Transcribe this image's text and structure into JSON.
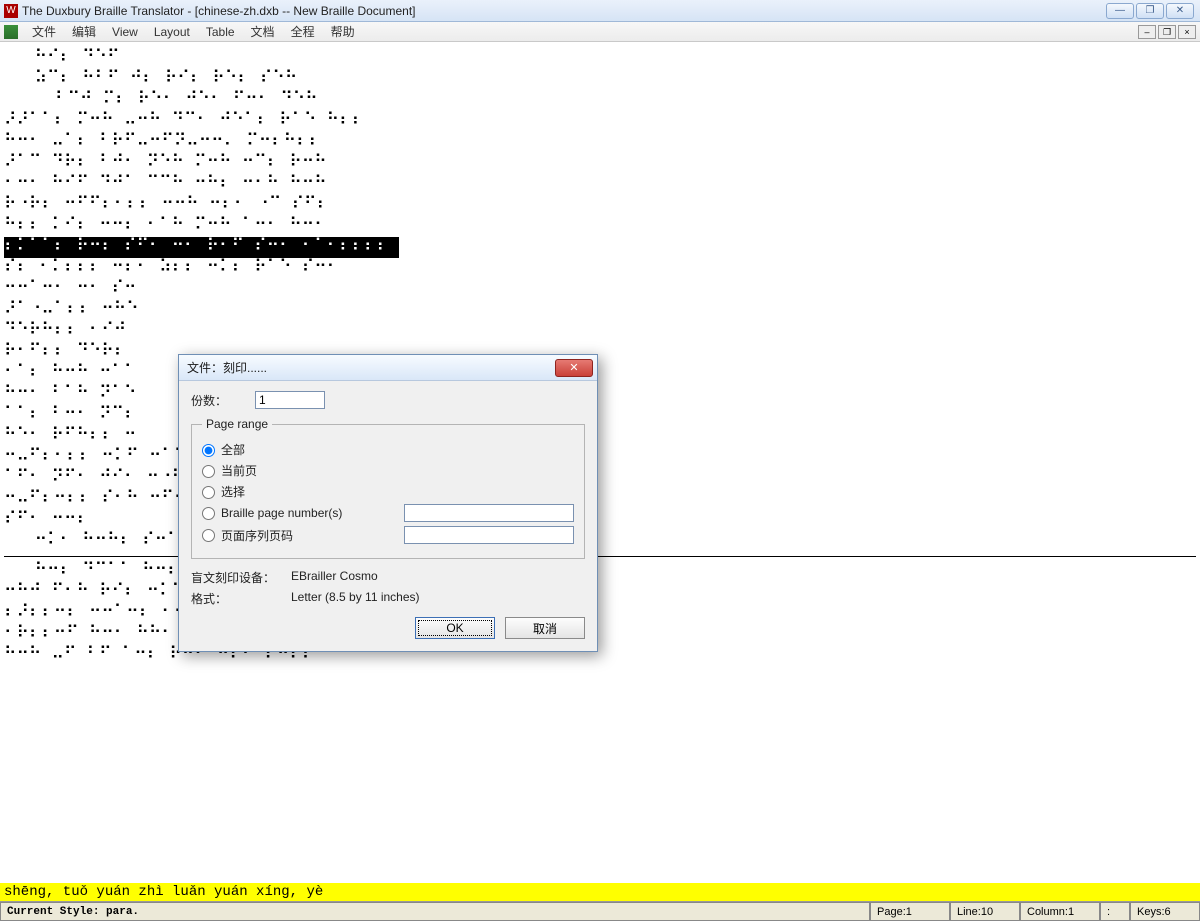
{
  "titlebar": {
    "title": "The Duxbury Braille Translator - [chinese-zh.dxb -- New Braille Document]"
  },
  "menu": {
    "items": [
      "文件",
      "编辑",
      "View",
      "Layout",
      "Table",
      "文档",
      "全程",
      "帮助"
    ]
  },
  "braille": {
    "lines_top": [
      "   ⠓⠊⠆ ⠙⠑⠋",
      "   ⠵⠉⠆ ⠓⠃⠋ ⠚⠆ ⠗⠊⠆ ⠗⠑⠆ ⠎⠑⠓",
      "     ⠃⠉⠚ ⠍⠆ ⠗⠑⠂ ⠚⠑⠂ ⠋⠒⠂ ⠙⠑⠓",
      "⠜⠜⠁⠁⠆ ⠍⠒⠓ ⠤⠒⠓ ⠙⠉⠂ ⠚⠑⠁⠆ ⠗⠁⠑ ⠓⠆⠆",
      "⠓⠒⠂ ⠤⠁⠆ ⠃⠗⠋⠤⠒⠋⠝⠤⠒⠒⠄ ⠍⠒⠆⠓⠆⠆",
      "⠜⠁⠉ ⠙⠗⠆ ⠃⠚⠂ ⠝⠑⠓ ⠍⠒⠓ ⠒⠉⠆ ⠗⠒⠓",
      "⠂⠒⠂ ⠓⠊⠋ ⠙⠚⠁ ⠉⠉⠓ ⠒⠓⠆ ⠒⠂⠓ ⠓⠒⠓",
      "⠗⠐⠗⠆ ⠒⠋⠋⠆⠂⠆⠆ ⠒⠒⠓ ⠒⠆⠂ ⠐⠉ ⠎⠋⠆",
      "⠓⠆⠆ ⠅⠊⠆ ⠒⠒⠆ ⠂⠁⠓ ⠍⠒⠓ ⠁⠒⠂ ⠓⠒⠂"
    ],
    "selected_line": "⠆⠅⠁⠁⠆ ⠗⠒⠆ ⠎⠋⠂ ⠒⠂ ⠗⠂⠋ ⠎⠒⠂ ⠂⠁⠂⠆⠆⠆⠆ ",
    "lines_after_sel": [
      "⠎⠆ ⠂⠅⠆⠆⠆ ⠒⠆⠂ ⠵⠆⠆ ⠒⠅⠆ ⠗⠁⠑ ⠎⠒⠂",
      "⠒⠒⠁⠒⠂ ⠒⠂ ⠎⠒",
      "⠜⠁⠐⠤⠁⠆⠆ ⠒⠓⠑",
      "⠙⠑⠗⠓⠆⠆ ⠂⠊⠚",
      "⠗⠂⠋⠆⠆ ⠙⠑⠗⠆",
      "⠂⠁⠆ ⠓⠒⠓ ⠒⠁⠁",
      "⠓⠒⠂ ⠃⠁⠓ ⠝⠁⠑",
      "⠁⠁⠆ ⠃⠒⠂ ⠝⠉⠆",
      "⠓⠑⠂ ⠗⠋⠓⠆⠆ ⠒",
      "⠒⠤⠋⠆⠂⠆⠆ ⠒⠅⠋ ⠒⠁⠁⠆⠒⠆⠆ ⠒⠆ ⠒⠂⠋",
      "⠁⠋⠂ ⠝⠋⠂ ⠚⠊⠂ ⠒⠐⠓ ⠃⠒⠆⠆⠆ ⠗⠋⠆",
      "⠒⠤⠋⠆⠒⠆⠆ ⠎⠂⠓ ⠒⠋⠒⠆⠆⠆ ⠒⠂⠂ ⠙⠋⠆",
      "⠎⠋⠂ ⠒⠒⠆",
      "   ⠒⠅⠂ ⠓⠒⠓⠆ ⠎⠒⠁⠁⠆ ⠓⠓⠂ ⠓⠒⠂"
    ],
    "lines_bottom": [
      "   ⠓⠒⠆ ⠙⠉⠁⠁ ⠓⠒⠆ ⠂⠂⠂ ⠝⠒⠗ ⠉⠒⠆ ⠂⠂⠁⠆  ⠓⠙⠗⠓",
      "⠒⠓⠚ ⠋⠂⠓ ⠗⠊⠆ ⠒⠅⠁⠁⠆⠃⠒⠓ ⠙⠋⠓⠆ ⠒⠆",
      "⠆⠜⠆⠆⠒⠆ ⠒⠒⠁⠒⠆ ⠂⠂⠆⠂ ⠒⠅⠂ ⠒⠂⠕⠆⠆ ⠒⠆",
      "⠂⠗⠆⠆⠒⠋ ⠓⠒⠂ ⠓⠓⠂ ⠒⠒⠚ ⠒⠁⠁⠆⠒⠆ ⠗⠒⠆",
      "⠓⠒⠓ ⠤⠋ ⠃⠋ ⠁⠒⠆ ⠗⠒⠂ ⠒⠆⠂ ⠆⠒⠆⠆"
    ]
  },
  "translation": "shēng, tuǒ yuán zhì luǎn yuán xíng, yè",
  "status": {
    "style": "Current Style: para.",
    "page": "Page:1",
    "line": "Line:10",
    "column": "Column:1",
    "extra": ":",
    "keys": "Keys:6"
  },
  "dialog": {
    "title": "文件：刻印......",
    "copies_label": "份数：",
    "copies_value": "1",
    "legend": "Page range",
    "opt_all": "全部",
    "opt_current": "当前页",
    "opt_select": "选择",
    "opt_braille": "Braille page number(s)",
    "opt_seq": "页面序列页码",
    "device_label": "盲文刻印设备：",
    "device_value": "EBrailler Cosmo",
    "format_label": "格式：",
    "format_value": "Letter (8.5 by 11 inches)",
    "btn_ok": "OK",
    "btn_cancel": "取消"
  }
}
